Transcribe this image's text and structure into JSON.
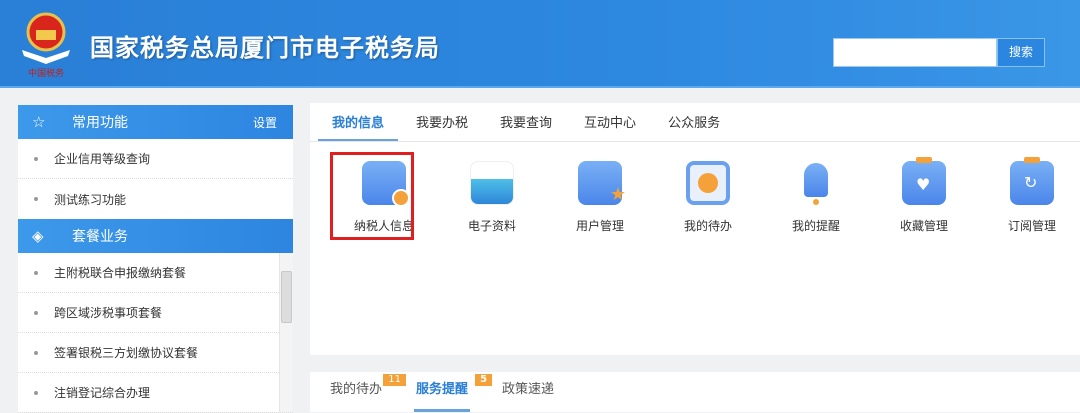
{
  "header": {
    "title": "国家税务总局厦门市电子税务局",
    "search_placeholder": "",
    "search_button": "搜索",
    "logo_text": "中国税务"
  },
  "sidebar": {
    "sections": [
      {
        "title": "常用功能",
        "action": "设置",
        "items": [
          "企业信用等级查询",
          "测试练习功能"
        ]
      },
      {
        "title": "套餐业务",
        "items": [
          "主附税联合申报缴纳套餐",
          "跨区域涉税事项套餐",
          "签署银税三方划缴协议套餐",
          "注销登记综合办理"
        ]
      }
    ]
  },
  "main": {
    "tabs": [
      "我的信息",
      "我要办税",
      "我要查询",
      "互动中心",
      "公众服务"
    ],
    "functions": [
      "纳税人信息",
      "电子资料",
      "用户管理",
      "我的待办",
      "我的提醒",
      "收藏管理",
      "订阅管理"
    ]
  },
  "bottom": {
    "tabs": [
      {
        "label": "我的待办",
        "badge": "11"
      },
      {
        "label": "服务提醒",
        "badge": "5"
      },
      {
        "label": "政策速递"
      }
    ]
  }
}
